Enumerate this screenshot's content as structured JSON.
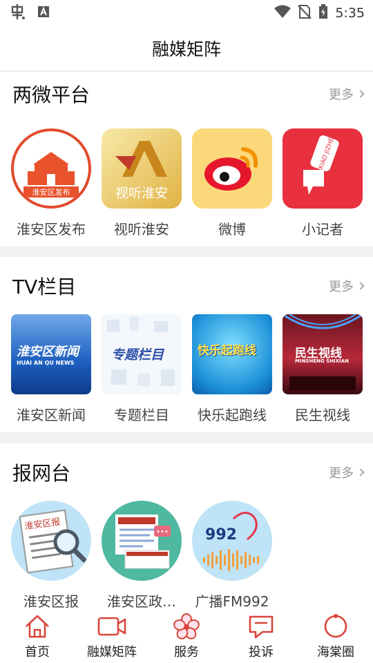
{
  "status_bar": {
    "time": "5:35"
  },
  "header": {
    "title": "融媒矩阵"
  },
  "sections": [
    {
      "title": "两微平台",
      "more": "更多",
      "items": [
        {
          "label": "淮安区发布",
          "logo_text": "淮安区发布",
          "icon": "gate-logo"
        },
        {
          "label": "视听淮安",
          "logo_text": "视听淮安",
          "icon": "av-logo"
        },
        {
          "label": "微博",
          "icon": "weibo-logo"
        },
        {
          "label": "小记者",
          "logo_text": "XIAO JIZHE",
          "icon": "microphone-logo"
        }
      ]
    },
    {
      "title": "TV栏目",
      "more": "更多",
      "items": [
        {
          "label": "淮安区新闻",
          "logo_text": "淮安区新闻",
          "logo_sub": "HUAI AN QU NEWS",
          "icon": "news-thumb"
        },
        {
          "label": "专题栏目",
          "logo_text": "专题栏目",
          "icon": "cubes-thumb"
        },
        {
          "label": "快乐起跑线",
          "logo_text": "快乐起跑线",
          "icon": "kids-thumb"
        },
        {
          "label": "民生视线",
          "logo_text": "民生视线",
          "logo_sub": "MINSHENG SHIXIAN",
          "icon": "stage-thumb"
        }
      ]
    },
    {
      "title": "报网台",
      "more": "更多",
      "items": [
        {
          "label": "淮安区报",
          "logo_text": "淮安区报",
          "icon": "newspaper-logo"
        },
        {
          "label": "淮安区政…",
          "icon": "website-logo"
        },
        {
          "label": "广播FM992",
          "logo_text": "992",
          "icon": "radio-logo"
        }
      ]
    }
  ],
  "tabs": [
    {
      "label": "首页",
      "icon": "home-icon"
    },
    {
      "label": "融媒矩阵",
      "icon": "video-camera-icon"
    },
    {
      "label": "服务",
      "icon": "flower-icon"
    },
    {
      "label": "投诉",
      "icon": "message-star-icon"
    },
    {
      "label": "海棠圈",
      "icon": "circle-pin-icon"
    }
  ],
  "colors": {
    "accent": "#d9453a",
    "divider": "#f2f2f2"
  }
}
